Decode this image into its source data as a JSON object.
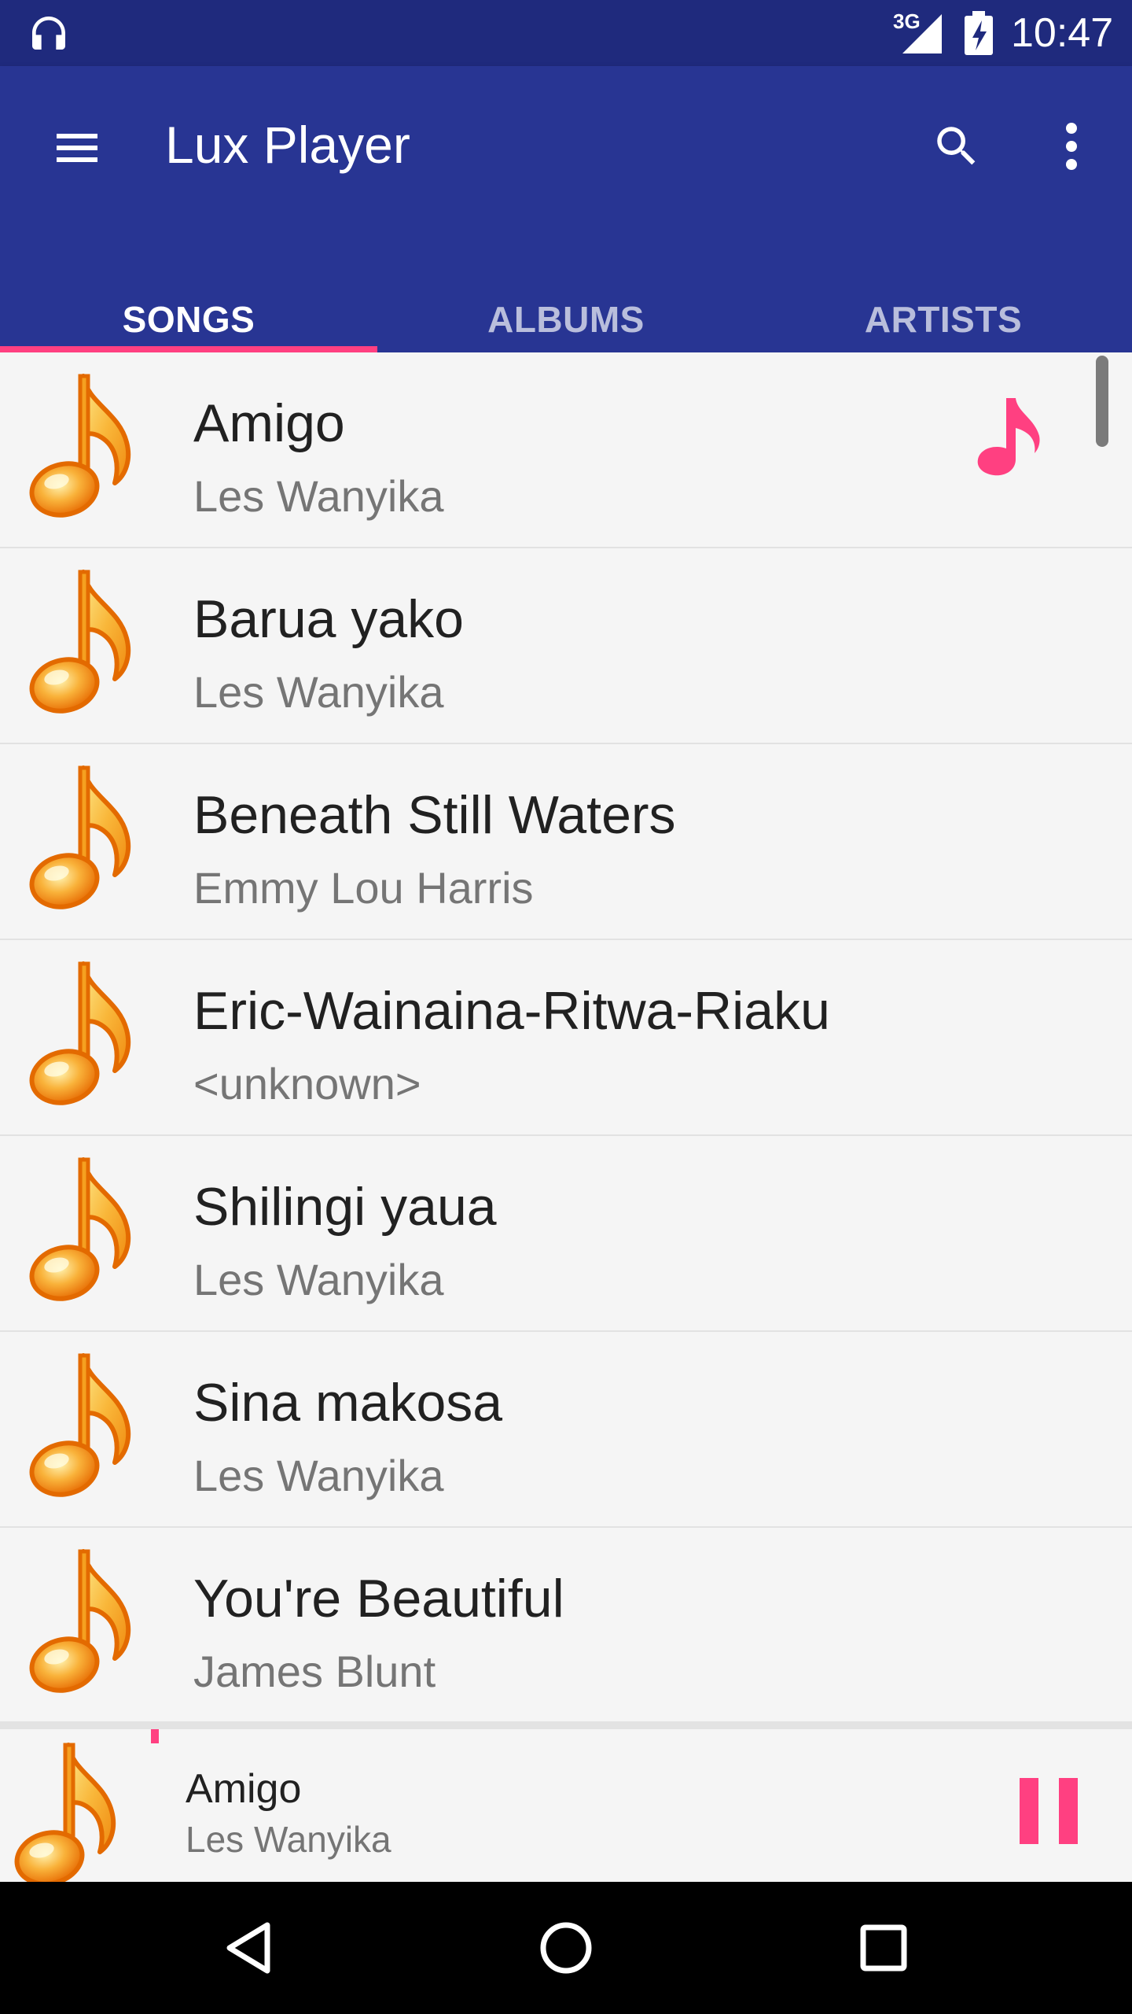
{
  "status_bar": {
    "network_label": "3G",
    "time": "10:47"
  },
  "app_bar": {
    "title": "Lux Player",
    "tabs": [
      {
        "label": "SONGS",
        "active": true
      },
      {
        "label": "ALBUMS",
        "active": false
      },
      {
        "label": "ARTISTS",
        "active": false
      }
    ]
  },
  "songs": [
    {
      "title": "Amigo",
      "artist": "Les Wanyika",
      "playing": true
    },
    {
      "title": "Barua yako",
      "artist": "Les Wanyika",
      "playing": false
    },
    {
      "title": "Beneath Still Waters",
      "artist": "Emmy Lou Harris",
      "playing": false
    },
    {
      "title": "Eric-Wainaina-Ritwa-Riaku",
      "artist": "<unknown>",
      "playing": false
    },
    {
      "title": "Shilingi yaua",
      "artist": "Les Wanyika",
      "playing": false
    },
    {
      "title": "Sina makosa",
      "artist": "Les Wanyika",
      "playing": false
    },
    {
      "title": "You're Beautiful",
      "artist": "James Blunt",
      "playing": false
    }
  ],
  "now_playing": {
    "title": "Amigo",
    "artist": "Les Wanyika"
  },
  "colors": {
    "status_bar": "#1f2a7d",
    "primary": "#283593",
    "accent": "#ff4081",
    "note_orange": "#f07f0a",
    "note_yellow": "#fbd24e"
  },
  "icons": {
    "status": [
      "headphones-icon",
      "signal-icon",
      "battery-charging-icon"
    ],
    "app_bar": [
      "menu-icon",
      "search-icon",
      "more-vert-icon"
    ],
    "song_art": "music-note-icon",
    "playing": "music-note-playing-icon",
    "player": "pause-icon",
    "nav": [
      "back-icon",
      "home-icon",
      "recents-icon"
    ]
  }
}
